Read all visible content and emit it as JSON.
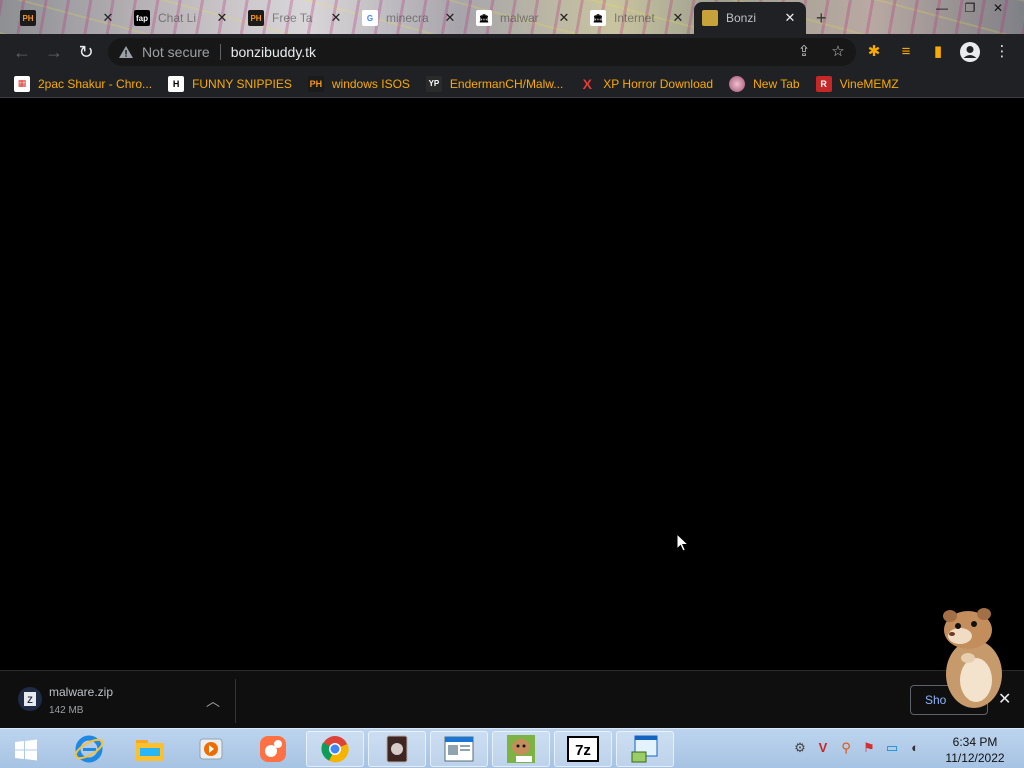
{
  "tabs": [
    {
      "title": "",
      "icon": "PH"
    },
    {
      "title": "Chat Li",
      "icon": "fap"
    },
    {
      "title": "Free Ta",
      "icon": "PH"
    },
    {
      "title": "minecra",
      "icon": "G"
    },
    {
      "title": "malwar",
      "icon": "archive"
    },
    {
      "title": "Internet",
      "icon": "archive"
    },
    {
      "title": "Bonzi",
      "icon": "bonzi"
    }
  ],
  "toolbar": {
    "security_label": "Not secure",
    "url": "bonzibuddy.tk"
  },
  "bookmarks": [
    {
      "label": "2pac Shakur - Chro...",
      "icon": "chrome-store"
    },
    {
      "label": "FUNNY SNIPPIES",
      "icon": "H"
    },
    {
      "label": "windows ISOS",
      "icon": "PH"
    },
    {
      "label": "EndermanCH/Malw...",
      "icon": "YP"
    },
    {
      "label": "XP Horror Download",
      "icon": "X"
    },
    {
      "label": "New Tab",
      "icon": "ball"
    },
    {
      "label": "VineMEMZ",
      "icon": "R"
    }
  ],
  "download": {
    "filename": "malware.zip",
    "size": "142 MB",
    "show_all": "Sho"
  },
  "taskbar": {
    "time": "6:34 PM",
    "date": "11/12/2022"
  }
}
